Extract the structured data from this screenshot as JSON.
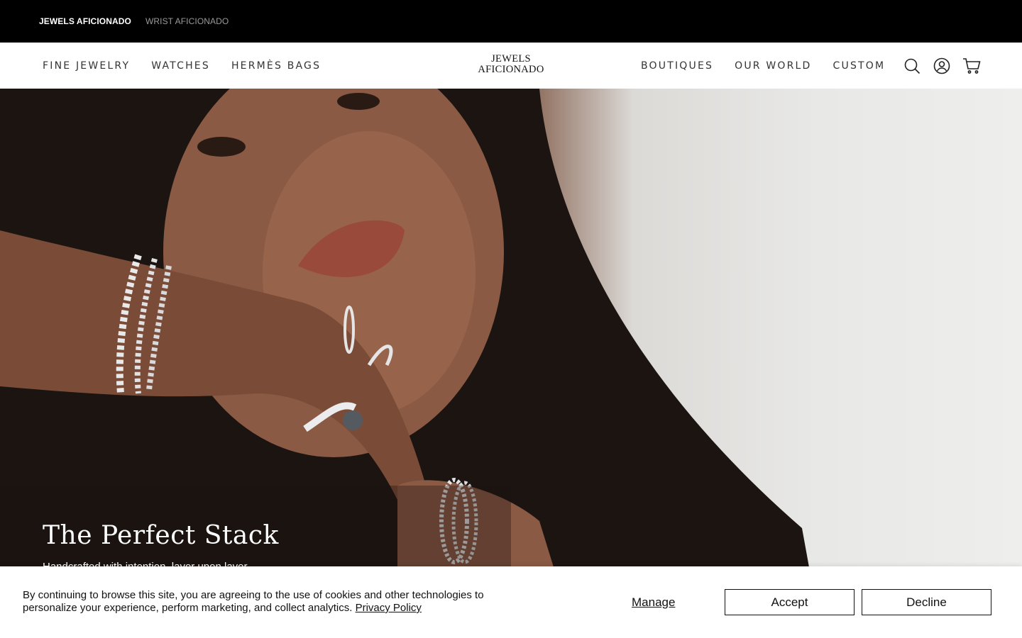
{
  "topbar": {
    "links": [
      {
        "label": "JEWELS AFICIONADO"
      },
      {
        "label": "WRIST AFICIONADO"
      }
    ]
  },
  "nav": {
    "left": [
      {
        "label": "FINE JEWELRY"
      },
      {
        "label": "WATCHES"
      },
      {
        "label": "HERMÈS BAGS"
      }
    ],
    "right": [
      {
        "label": "BOUTIQUES"
      },
      {
        "label": "OUR WORLD"
      },
      {
        "label": "CUSTOM"
      }
    ],
    "icons": [
      "search-icon",
      "account-icon",
      "cart-icon"
    ]
  },
  "logo": {
    "line1": "JEWELS",
    "line2": "AFICIONADO"
  },
  "hero": {
    "title": "The Perfect Stack",
    "subtitle": "Handcrafted with intention, layer upon layer"
  },
  "cookie": {
    "text": "By continuing to browse this site, you are agreeing to the use of cookies and other technologies to personalize your experience, perform marketing, and collect analytics.",
    "policy_link": "Privacy Policy",
    "manage_label": "Manage",
    "accept_label": "Accept",
    "decline_label": "Decline"
  },
  "colors": {
    "topbar_bg": "#000000",
    "text_dark": "#111111",
    "topbar_inactive": "#9a9a9a"
  }
}
